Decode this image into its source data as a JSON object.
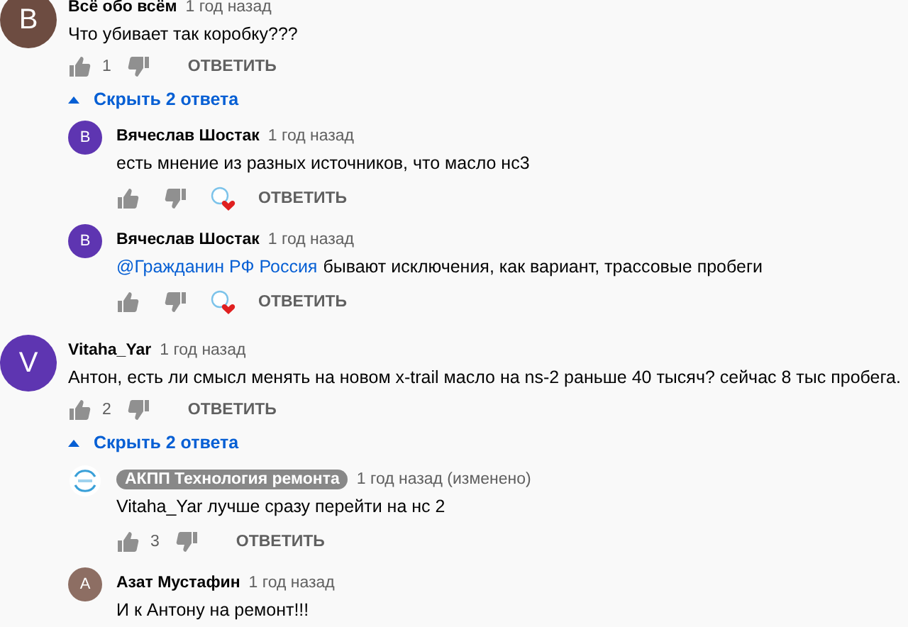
{
  "comments": [
    {
      "avatar_letter": "В",
      "color": "#6d4c41",
      "author": "Всё обо всём",
      "time": "1 год назад",
      "text": "Что убивает так коробку???",
      "likes": "1",
      "reply_label": "ОТВЕТИТЬ",
      "replies_toggle": {
        "label": "Скрыть 2 ответа",
        "expanded": true
      },
      "replies": [
        {
          "kind": "user",
          "avatar_letter": "В",
          "color": "#5e35b1",
          "author": "Вячеслав Шостак",
          "time": "1 год назад",
          "text": "есть мнение из разных источников, что масло нс3",
          "creator_heart": true,
          "reply_label": "ОТВЕТИТЬ"
        },
        {
          "kind": "user",
          "avatar_letter": "В",
          "color": "#5e35b1",
          "author": "Вячеслав Шостак",
          "time": "1 год назад",
          "mention": "@Гражданин РФ Россия",
          "text": "бывают исключения, как вариант, трассовые пробеги",
          "creator_heart": true,
          "reply_label": "ОТВЕТИТЬ"
        }
      ]
    },
    {
      "avatar_letter": "V",
      "color": "#5e35b1",
      "author": "Vitaha_Yar",
      "time": "1 год назад",
      "text": "Антон, есть ли смысл менять на новом x-trail масло на ns-2 раньше 40 тысяч? сейчас 8 тыс пробега.",
      "likes": "2",
      "reply_label": "ОТВЕТИТЬ",
      "replies_toggle": {
        "label": "Скрыть 2 ответа",
        "expanded": true
      },
      "replies": [
        {
          "kind": "owner",
          "author": "АКПП Технология ремонта",
          "time": "1 год назад (изменено)",
          "text": "Vitaha_Yar лучше сразу перейти на нс 2",
          "likes": "3",
          "creator_heart": false,
          "reply_label": "ОТВЕТИТЬ"
        },
        {
          "kind": "user",
          "avatar_letter": "А",
          "color": "#8d6e63",
          "author": "Азат Мустафин",
          "time": "1 год назад",
          "text": "И к Антону на ремонт!!!",
          "creator_heart": false
        }
      ]
    }
  ]
}
